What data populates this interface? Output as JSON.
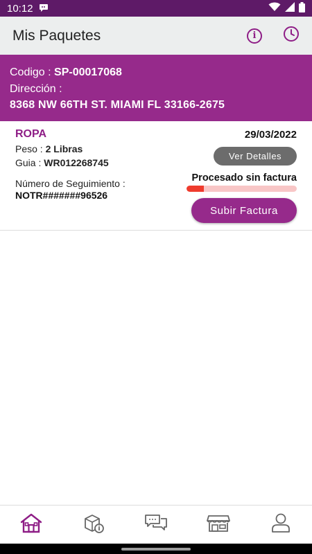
{
  "status_bar": {
    "time": "10:12"
  },
  "app_bar": {
    "title": "Mis Paquetes"
  },
  "address_panel": {
    "code_label": "Codigo : ",
    "code_value": "SP-00017068",
    "address_label": "Dirección :",
    "address_value": "8368 NW 66TH ST. MIAMI FL 33166-2675"
  },
  "package": {
    "category": "ROPA",
    "date": "29/03/2022",
    "weight_label": "Peso : ",
    "weight_value": "2 Libras",
    "guide_label": "Guia : ",
    "guide_value": "WR012268745",
    "tracking_label": "Número de Seguimiento :",
    "tracking_value": "NOTR#######96526",
    "details_button": "Ver Detalles",
    "status": "Procesado sin factura",
    "progress_fraction": 0.16,
    "upload_button": "Subir Factura"
  },
  "colors": {
    "status_bar": "#5e1a67",
    "brand_purple": "#962a8b",
    "accent_text": "#8e1d86",
    "progress_fill": "#ef3b2d",
    "progress_track": "#f8c6c6",
    "details_button": "#6c6c6c"
  },
  "icons": {
    "nav": [
      "home-icon",
      "package-info-icon",
      "chat-icon",
      "store-icon",
      "user-icon"
    ]
  }
}
